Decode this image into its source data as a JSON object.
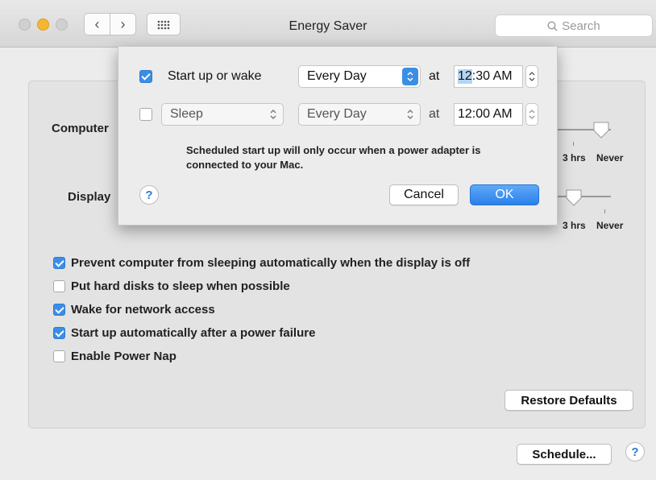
{
  "window": {
    "title": "Energy Saver",
    "search_placeholder": "Search",
    "nav_back": "‹",
    "nav_forward": "›"
  },
  "main": {
    "computer_label": "Computer",
    "display_label": "Display",
    "computer_slider": {
      "end_labels": [
        "3 hrs",
        "Never"
      ],
      "selected": "Never"
    },
    "display_slider": {
      "end_labels": [
        "3 hrs",
        "Never"
      ],
      "selected": "3 hrs"
    },
    "options": [
      {
        "label": "Prevent computer from sleeping automatically when the display is off",
        "checked": true
      },
      {
        "label": "Put hard disks to sleep when possible",
        "checked": false
      },
      {
        "label": "Wake for network access",
        "checked": true
      },
      {
        "label": "Start up automatically after a power failure",
        "checked": true
      },
      {
        "label": "Enable Power Nap",
        "checked": false
      }
    ],
    "restore_defaults": "Restore Defaults",
    "schedule": "Schedule...",
    "help": "?"
  },
  "sheet": {
    "row1": {
      "checked": true,
      "label": "Start up or wake",
      "frequency": "Every Day",
      "at": "at",
      "time_hour": "12",
      "time_rest": ":30 AM"
    },
    "row2": {
      "checked": false,
      "action": "Sleep",
      "frequency": "Every Day",
      "at": "at",
      "time": "12:00 AM"
    },
    "note": "Scheduled start up will only occur when a power adapter is connected to your Mac.",
    "help": "?",
    "cancel": "Cancel",
    "ok": "OK"
  },
  "colors": {
    "accent": "#3a8ee6",
    "minimize": "#f5b730"
  }
}
